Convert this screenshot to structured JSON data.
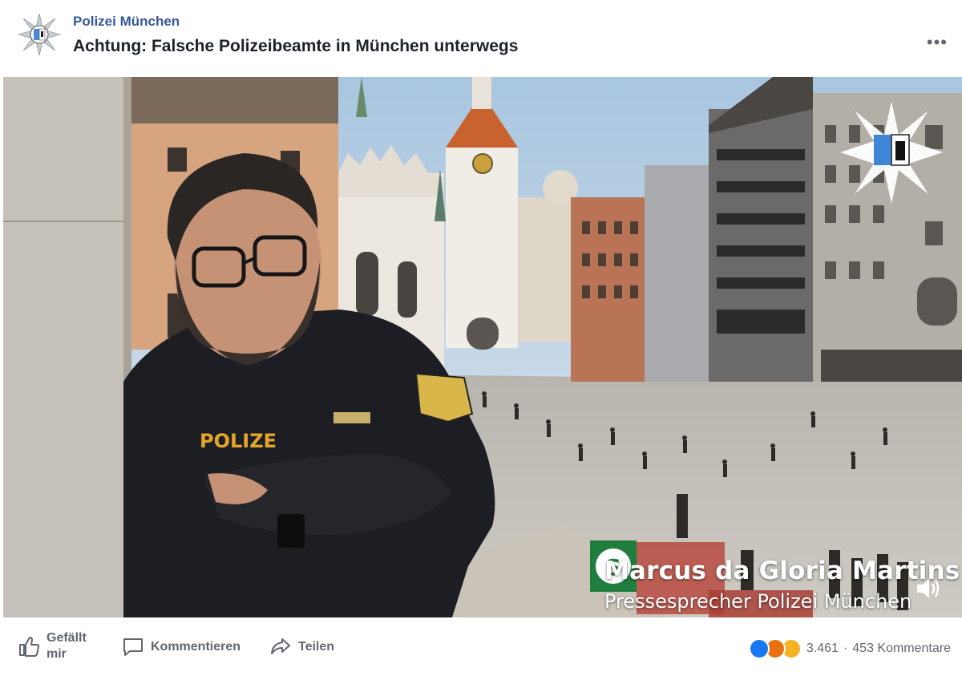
{
  "header": {
    "page_name": "Polizei München",
    "post_title": "Achtung: Falsche Polizeibeamte in München unterwegs",
    "more_label": "•••"
  },
  "video": {
    "speaker_name": "Marcus da Gloria Martins",
    "speaker_role": "Pressesprecher Polizei München",
    "uniform_text": "POLIZE",
    "sign_letter": "S"
  },
  "actions": {
    "like_label": "Gefällt mir",
    "comment_label": "Kommentieren",
    "share_label": "Teilen"
  },
  "reactions": {
    "count": "3.461",
    "separator": "·",
    "comments": "453 Kommentare",
    "colors": {
      "like": "#1877f2",
      "angry": "#e9710f",
      "sad": "#f7b125"
    }
  },
  "icons": [
    "police-star-logo-icon",
    "more-options-icon",
    "volume-icon",
    "like-thumb-icon",
    "comment-bubble-icon",
    "share-arrow-icon",
    "like-reaction-icon",
    "angry-reaction-icon",
    "sad-reaction-icon"
  ]
}
